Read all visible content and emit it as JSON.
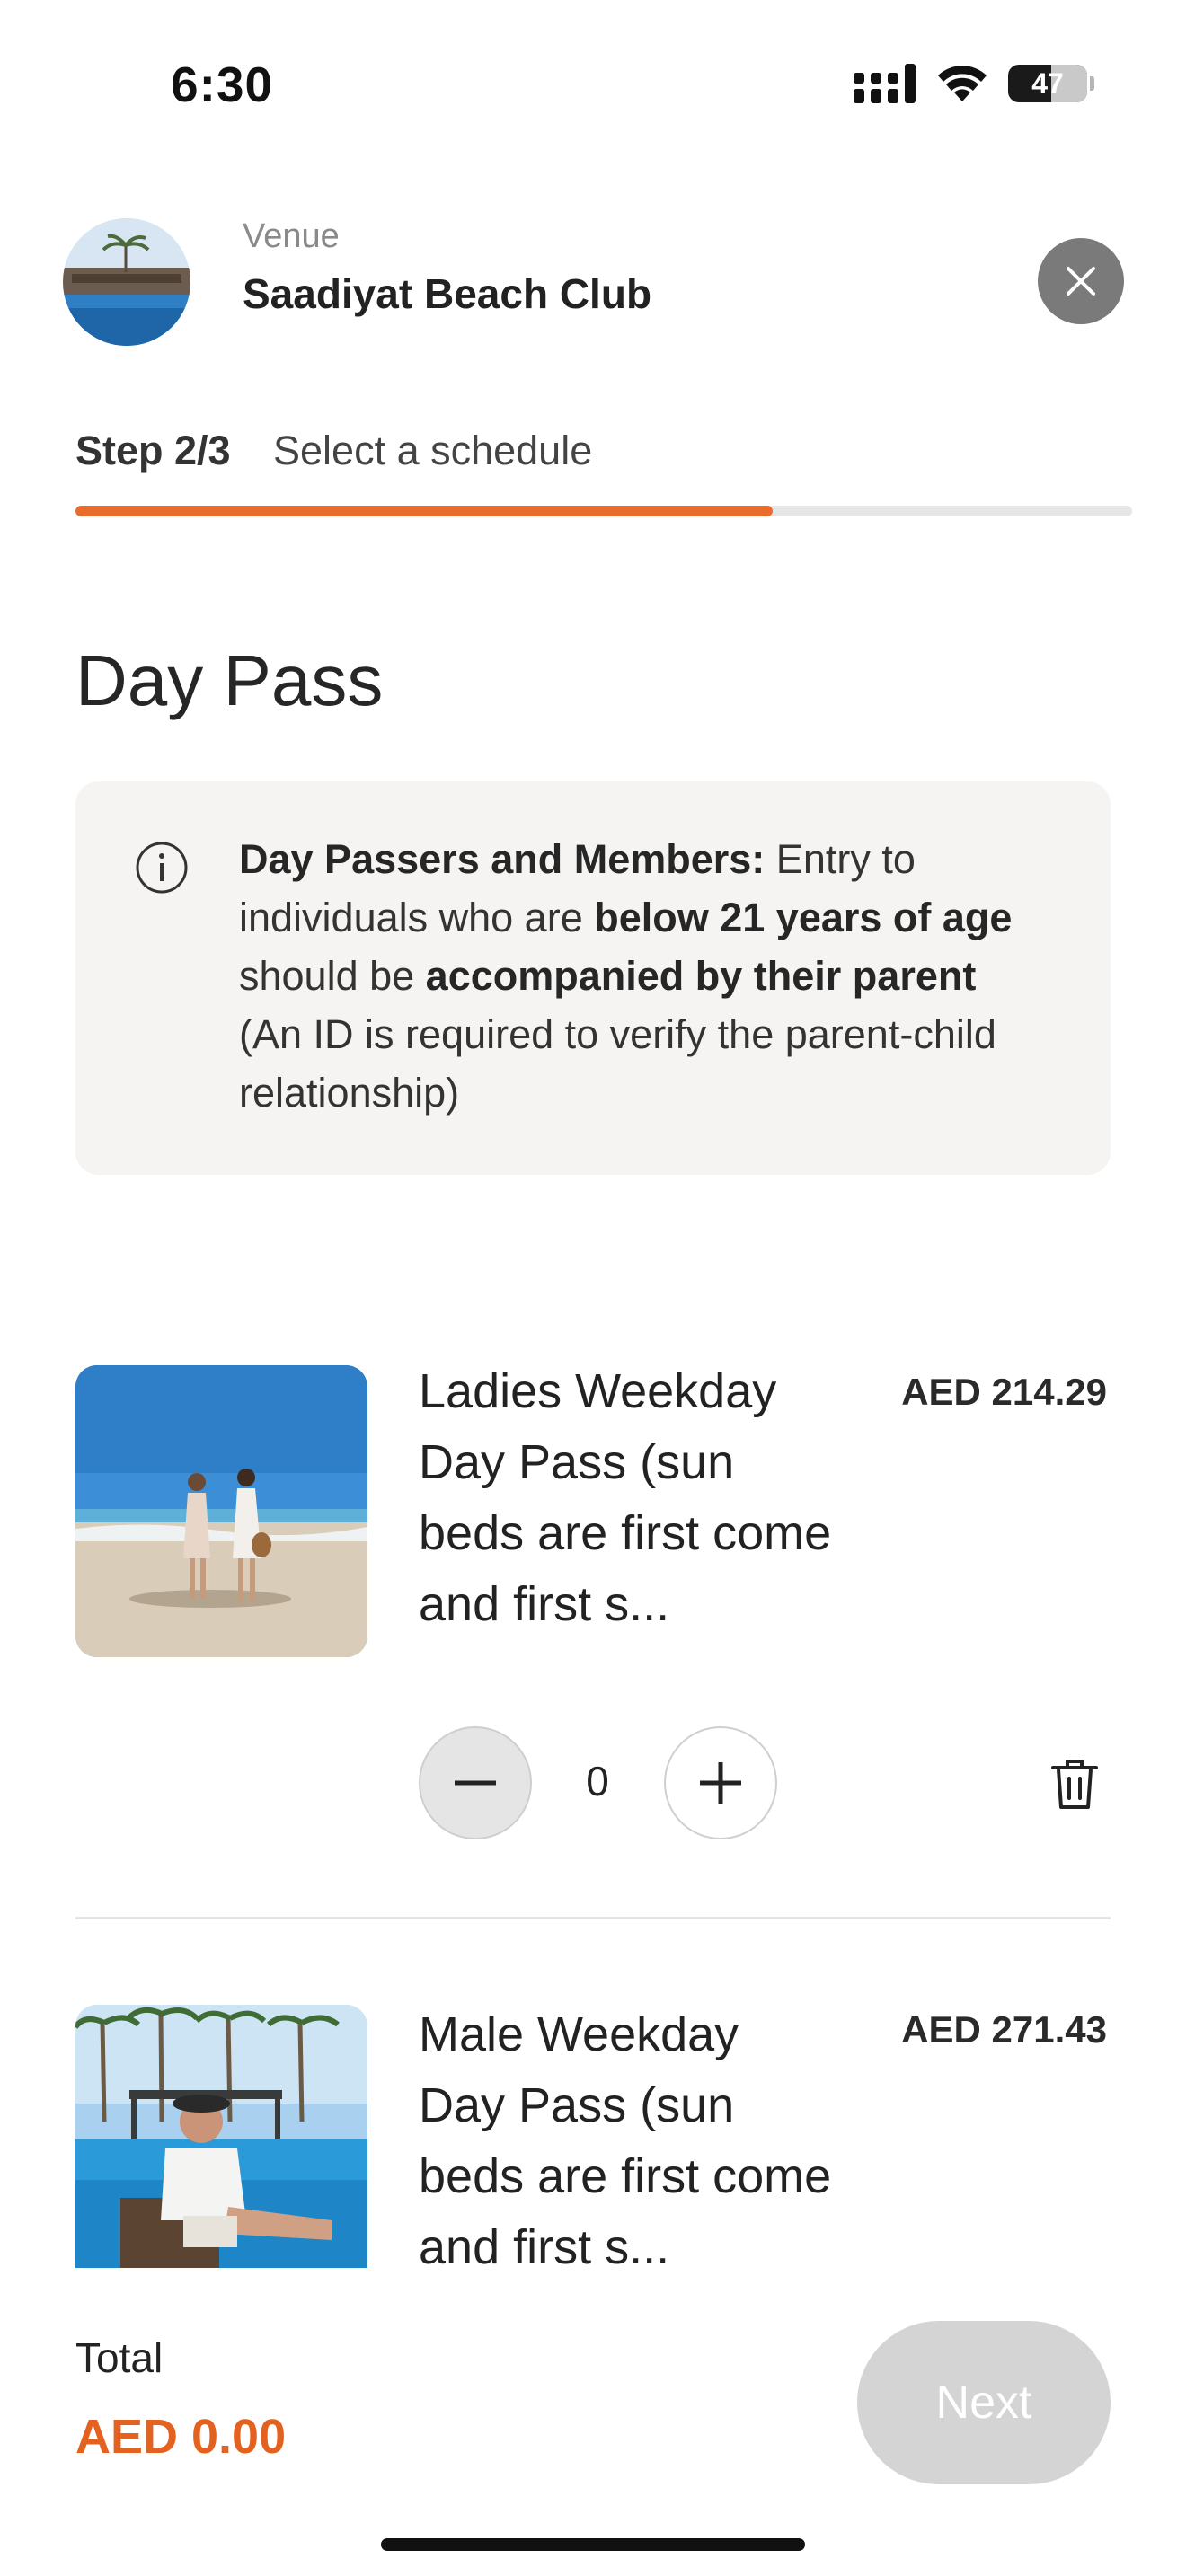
{
  "status_bar": {
    "time": "6:30",
    "battery": "47"
  },
  "header": {
    "venue_caption": "Venue",
    "venue_name": "Saadiyat Beach Club"
  },
  "step": {
    "label": "Step 2/3",
    "title": "Select a schedule",
    "progress": 0.66
  },
  "section": {
    "title": "Day Pass"
  },
  "info": {
    "part1_bold": "Day Passers and Members:",
    "part2": " Entry to individuals who are ",
    "part3_bold": "below 21 years of age",
    "part4": " should be ",
    "part5_bold": "accompanied by their parent",
    "part6": " (An ID is required to verify the parent-child relationship)"
  },
  "products": [
    {
      "name": "Ladies Weekday Day Pass (sun beds are first come and first s...",
      "price": "AED 214.29",
      "quantity": "0"
    },
    {
      "name": "Male Weekday Day Pass (sun beds are first come and first s...",
      "price": "AED 271.43"
    }
  ],
  "footer": {
    "total_label": "Total",
    "total_value": "AED 0.00",
    "next_label": "Next"
  },
  "colors": {
    "accent": "#ea6c2c",
    "total": "#e4621f",
    "close_bg": "#7a7a7a",
    "next_disabled": "#d4d4d4"
  }
}
